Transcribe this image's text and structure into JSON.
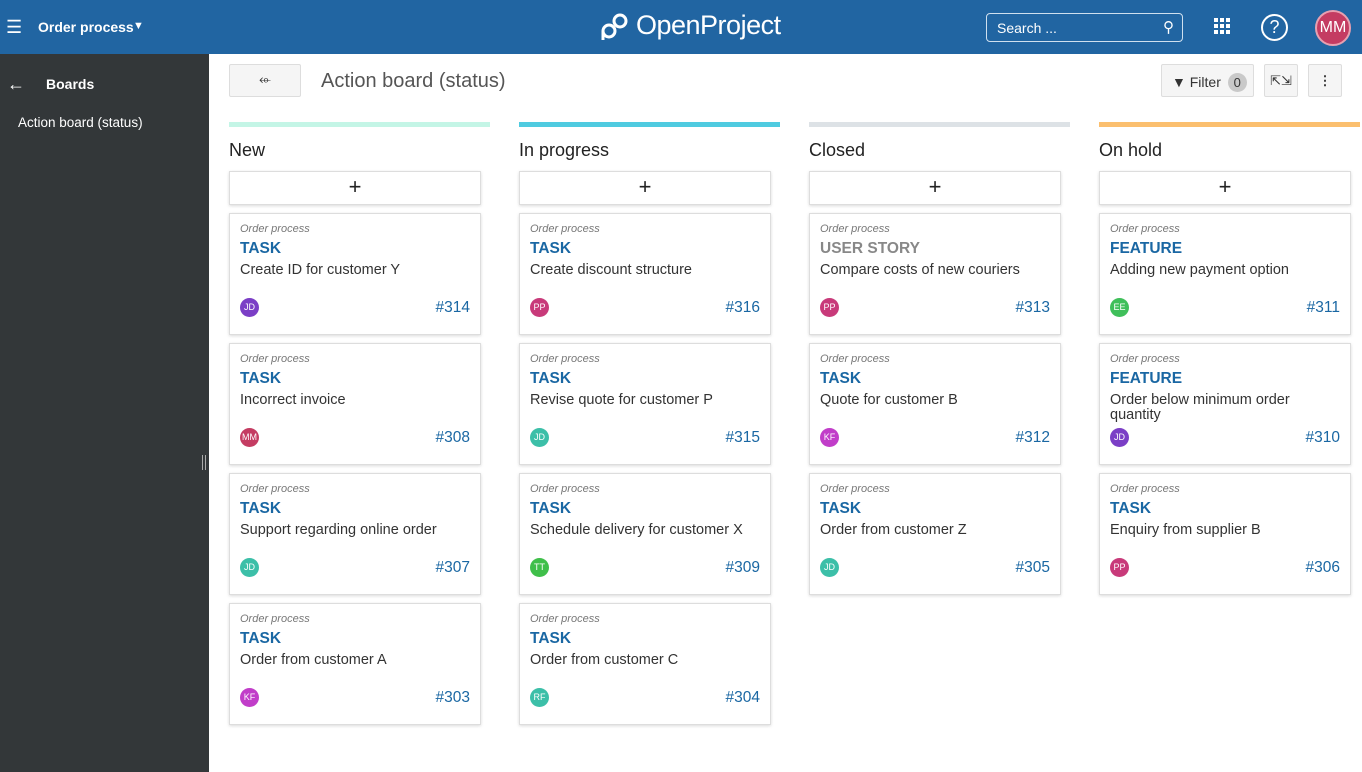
{
  "header": {
    "project": "Order process",
    "logo": "OpenProject",
    "search_placeholder": "Search ...",
    "user_initials": "MM",
    "user_color": "#c43c62"
  },
  "sidebar": {
    "title": "Boards",
    "items": [
      {
        "label": "Action board (status)"
      }
    ]
  },
  "toolbar": {
    "back_icon": "arrow-left-icon",
    "title": "Action board (status)",
    "filter_label": "Filter",
    "filter_count": "0"
  },
  "columns": [
    {
      "name": "New",
      "color": "#c4f5e6",
      "cards": [
        {
          "project": "Order process",
          "type": "TASK",
          "subject": "Create ID for customer Y",
          "assignee": "JD",
          "color": "#7b3ec6",
          "id": "#314"
        },
        {
          "project": "Order process",
          "type": "TASK",
          "subject": "Incorrect invoice",
          "assignee": "MM",
          "color": "#c43c62",
          "id": "#308"
        },
        {
          "project": "Order process",
          "type": "TASK",
          "subject": "Support regarding online order",
          "assignee": "JD",
          "color": "#3cbfa8",
          "id": "#307"
        },
        {
          "project": "Order process",
          "type": "TASK",
          "subject": "Order from customer A",
          "assignee": "KF",
          "color": "#c13dc9",
          "id": "#303"
        }
      ]
    },
    {
      "name": "In progress",
      "color": "#4fcbe0",
      "cards": [
        {
          "project": "Order process",
          "type": "TASK",
          "subject": "Create discount structure",
          "assignee": "PP",
          "color": "#c83a7a",
          "id": "#316"
        },
        {
          "project": "Order process",
          "type": "TASK",
          "subject": "Revise quote for customer P",
          "assignee": "JD",
          "color": "#3cbfa8",
          "id": "#315"
        },
        {
          "project": "Order process",
          "type": "TASK",
          "subject": "Schedule delivery for customer X",
          "assignee": "TT",
          "color": "#3fbf4a",
          "id": "#309"
        },
        {
          "project": "Order process",
          "type": "TASK",
          "subject": "Order from customer C",
          "assignee": "RF",
          "color": "#3cbfa8",
          "id": "#304"
        }
      ]
    },
    {
      "name": "Closed",
      "color": "#dde2e6",
      "cards": [
        {
          "project": "Order process",
          "type": "USER STORY",
          "subject": "Compare costs of new couriers",
          "assignee": "PP",
          "color": "#c83a7a",
          "id": "#313"
        },
        {
          "project": "Order process",
          "type": "TASK",
          "subject": "Quote for customer B",
          "assignee": "KF",
          "color": "#c13dc9",
          "id": "#312"
        },
        {
          "project": "Order process",
          "type": "TASK",
          "subject": "Order from customer Z",
          "assignee": "JD",
          "color": "#3cbfa8",
          "id": "#305"
        }
      ]
    },
    {
      "name": "On hold",
      "color": "#fbbf6f",
      "cards": [
        {
          "project": "Order process",
          "type": "FEATURE",
          "subject": "Adding new payment option",
          "assignee": "EE",
          "color": "#3fbf5a",
          "id": "#311"
        },
        {
          "project": "Order process",
          "type": "FEATURE",
          "subject": "Order below minimum order quantity",
          "assignee": "JD",
          "color": "#7b3ec6",
          "id": "#310"
        },
        {
          "project": "Order process",
          "type": "TASK",
          "subject": "Enquiry from supplier B",
          "assignee": "PP",
          "color": "#c83a7a",
          "id": "#306"
        }
      ]
    }
  ]
}
